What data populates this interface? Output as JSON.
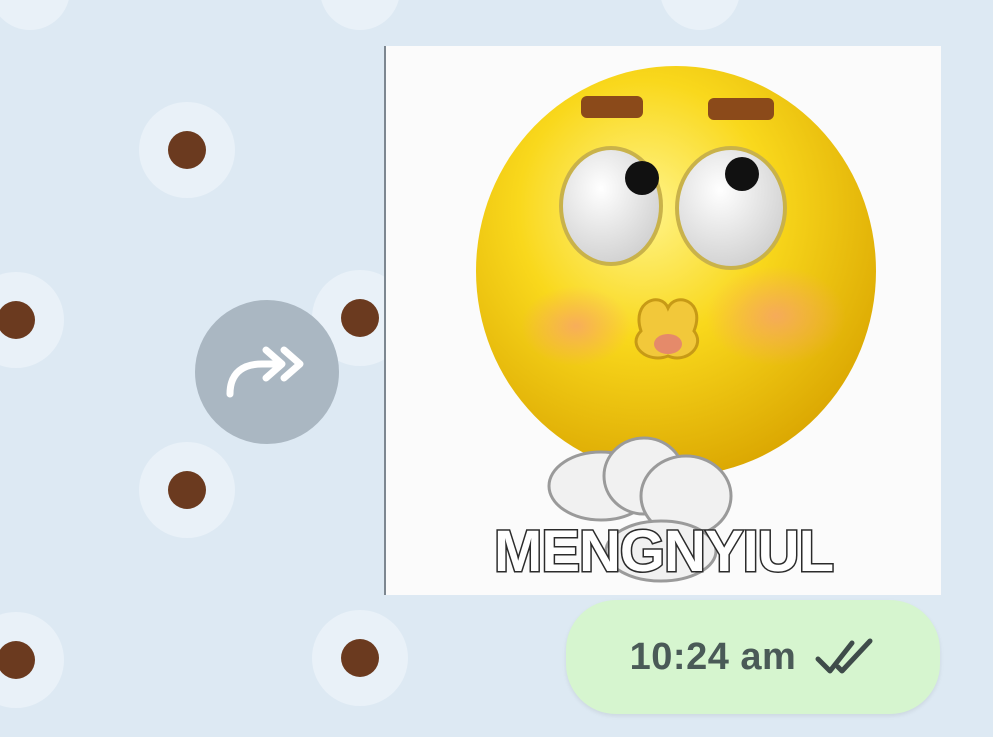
{
  "message": {
    "sticker": {
      "caption": "MENGNYIUL",
      "icon": "kissing-emoji-sticker"
    },
    "timestamp": "10:24 am",
    "status_icon": "double-check-icon"
  },
  "forward_button": {
    "icon": "forward-arrow-icon"
  },
  "colors": {
    "background": "#dde9f3",
    "bubble": "#d6f5cf",
    "forward_button": "#aab7c2",
    "dot": "#6b3a1f"
  }
}
